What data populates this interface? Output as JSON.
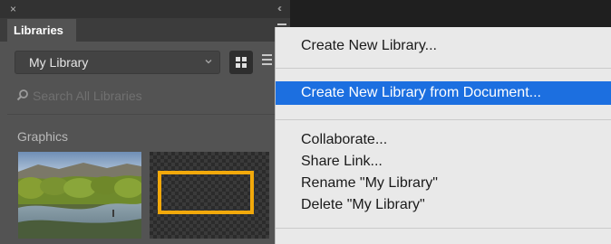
{
  "panel": {
    "close_glyph": "×",
    "collapse_glyph": "‹‹",
    "tab_label": "Libraries",
    "library_select": {
      "value": "My Library"
    },
    "search": {
      "placeholder": "Search All Libraries"
    },
    "section_label": "Graphics",
    "view_mode": "grid"
  },
  "menu": {
    "items": [
      {
        "label": "Create New Library..."
      },
      {
        "label": "Create New Library from Document...",
        "highlighted": true
      },
      {
        "label": "Collaborate..."
      },
      {
        "label": "Share Link..."
      },
      {
        "label": "Rename \"My Library\""
      },
      {
        "label": "Delete \"My Library\""
      }
    ]
  },
  "colors": {
    "panel_bg": "#535353",
    "menu_bg": "#e9e9e9",
    "highlight": "#1c6fe0",
    "orange_accent": "#f2a90b"
  }
}
